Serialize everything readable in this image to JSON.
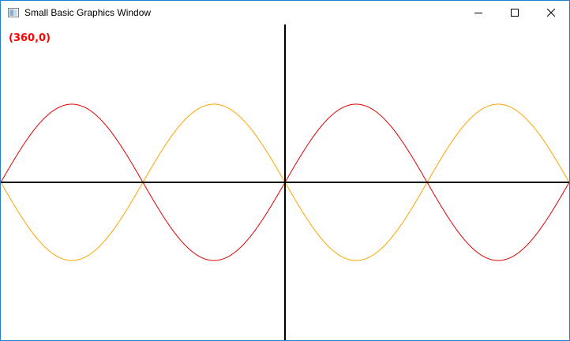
{
  "window": {
    "title": "Small Basic Graphics Window",
    "icon": "small-basic-app-icon",
    "controls": [
      "minimize-icon",
      "maximize-icon",
      "close-icon"
    ],
    "border_color": "#1f7fd4"
  },
  "canvas": {
    "background": "#ffffff",
    "coordinate_readout": "(360,0)",
    "readout_color": "#ff0000",
    "axis_color": "#000000"
  },
  "chart_data": {
    "type": "line",
    "xlim": [
      0,
      720
    ],
    "ylim": [
      -100,
      100
    ],
    "grid": false,
    "series": [
      {
        "function": "sin",
        "color": "#e00000",
        "amplitude": 100,
        "period": 360,
        "phase": 0
      },
      {
        "function": "-sin",
        "color": "#ffa500",
        "amplitude": 100,
        "period": 360,
        "phase": 0
      }
    ]
  }
}
